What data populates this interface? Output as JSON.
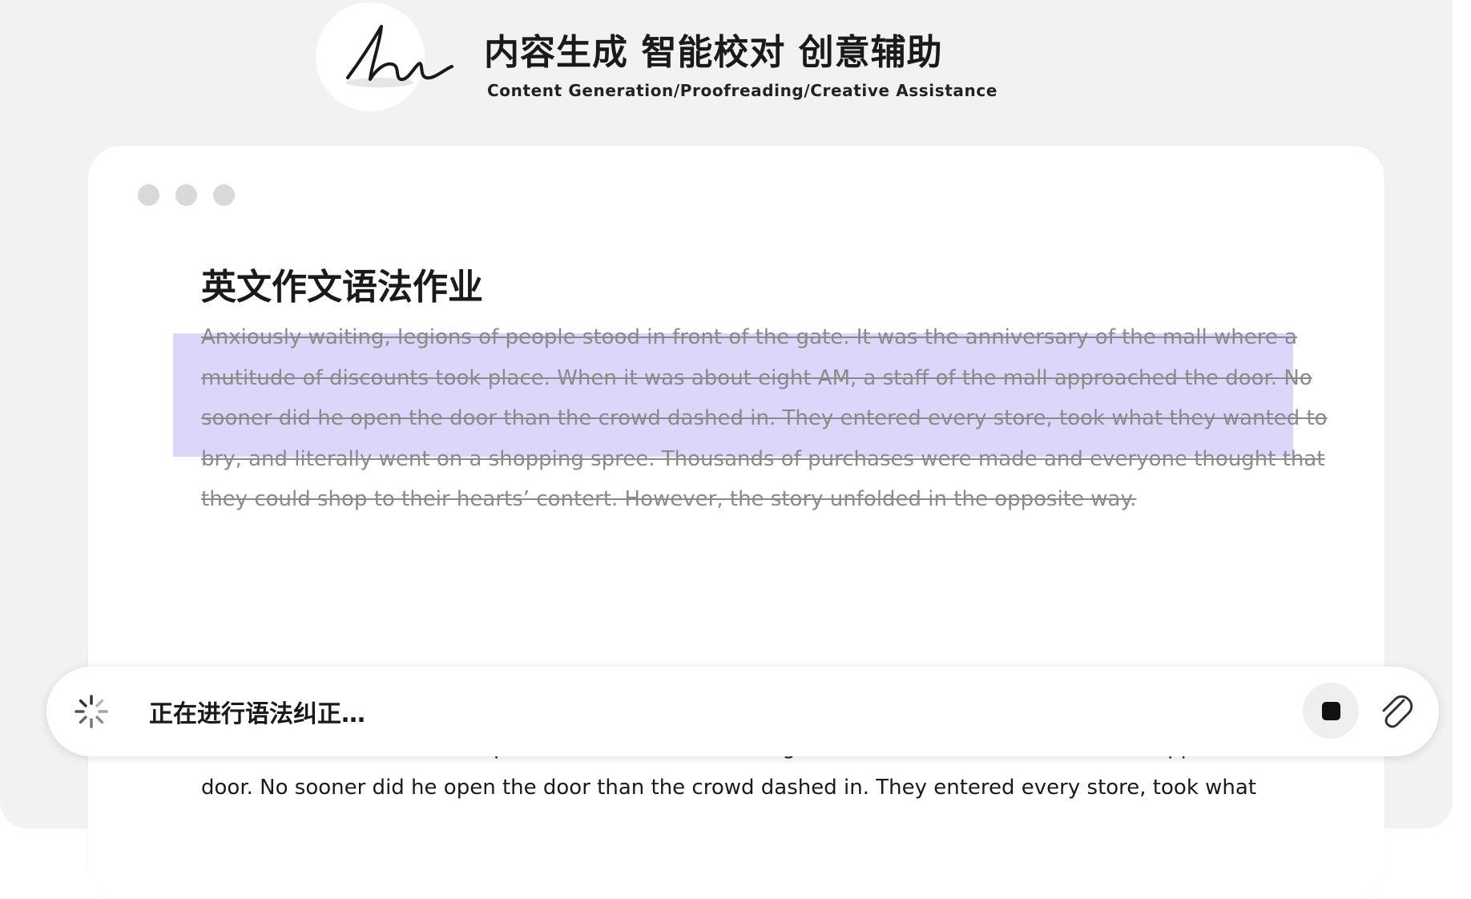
{
  "header": {
    "title": "内容生成 智能校对 创意辅助",
    "subtitle": "Content Generation/Proofreading/Creative Assistance",
    "logo_icon": "signature-logo-icon"
  },
  "window": {
    "control_dots": [
      "dot",
      "dot",
      "dot"
    ]
  },
  "document": {
    "title": "英文作文语法作业",
    "original_text": "Anxiously waiting, legions of people stood in front of the gate. It was the anniversary of the mall where a mutitude of discounts took place. When it was about eight AM, a staff of the mall approached the door. No sooner did he open the door than the crowd dashed in. They entered every store, took what they wanted to bry, and literally went on a shopping spree. Thousands of purchases were made and everyone thought that they could shop to their hearts’ contert. However, the story unfolded in the opposite way.",
    "corrected_text": "Anxiously waiting, legions of people stood in front of the gate. It was the anniversary of the mall where a multitude of discounts took place. When it was about eight AM, a staff member of the mall approached the door. No sooner did he open the door than the crowd dashed in. They entered every store, took what",
    "highlight_color": "#ddd6fb"
  },
  "input_bar": {
    "status": "正在进行语法纠正…",
    "status_icon": "loading-spinner-icon",
    "stop_icon": "stop-icon",
    "attach_icon": "paperclip-icon"
  }
}
